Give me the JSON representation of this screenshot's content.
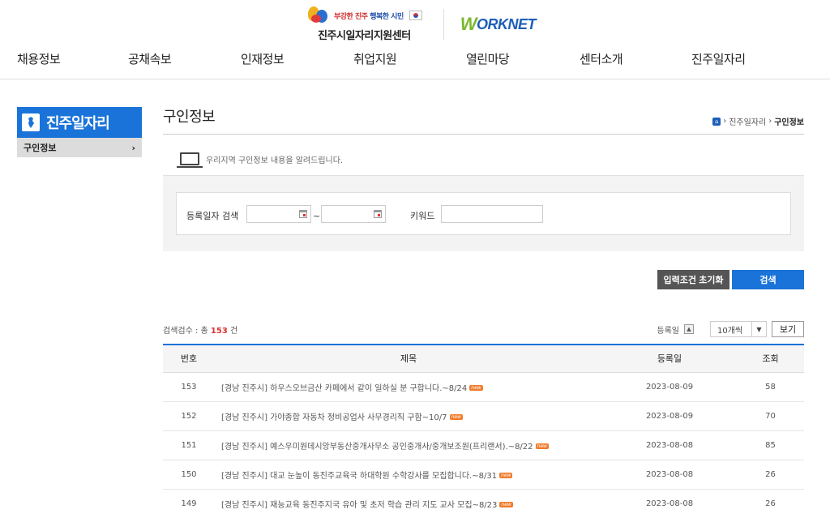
{
  "header": {
    "slogan_accent": "부강한 진주",
    "slogan_rest": "행복한 시민",
    "center_name": "진주시일자리지원센터",
    "worknet_w": "W",
    "worknet_rest": "ORKNET"
  },
  "nav": [
    "채용정보",
    "공채속보",
    "인재정보",
    "취업지원",
    "열린마당",
    "센터소개",
    "진주일자리"
  ],
  "sidebar": {
    "title": "진주일자리",
    "item": "구인정보",
    "chevron": "›"
  },
  "page": {
    "title": "구인정보",
    "breadcrumb": [
      "진주일자리",
      "구인정보"
    ],
    "intro": "우리지역 구인정보 내용을 알려드립니다."
  },
  "search": {
    "date_label": "등록일자 검색",
    "tilde": "~",
    "keyword_label": "키워드",
    "reset_label": "입력조건 초기화",
    "search_label": "검색"
  },
  "list": {
    "count_prefix": "검색검수 : 총",
    "count": "153",
    "count_suffix": "건",
    "sort_label": "등록일",
    "per_page": "10개씩",
    "view_label": "보기",
    "columns": [
      "번호",
      "제목",
      "등록일",
      "조회"
    ],
    "new_badge": "new",
    "rows": [
      {
        "no": "153",
        "title": "[경남 진주시] 하우스오브금산 카페에서 같이 일하실 분 구합니다.~8/24",
        "date": "2023-08-09",
        "views": "58"
      },
      {
        "no": "152",
        "title": "[경남 진주시] 가야종합 자동차 정비공업사 사무경리직 구함~10/7",
        "date": "2023-08-09",
        "views": "70"
      },
      {
        "no": "151",
        "title": "[경남 진주시] 예스우미원데시앙부동산중개사무소 공인중개사/중개보조원(프리랜서).~8/22",
        "date": "2023-08-08",
        "views": "85"
      },
      {
        "no": "150",
        "title": "[경남 진주시] 대교 눈높이 동진주교육국 하대학원 수학강사를 모집합니다.~8/31",
        "date": "2023-08-08",
        "views": "26"
      },
      {
        "no": "149",
        "title": "[경남 진주시] 재능교육 동진주지국 유아 및 초저 학습 관리 지도 교사 모집~8/23",
        "date": "2023-08-08",
        "views": "26"
      }
    ]
  }
}
